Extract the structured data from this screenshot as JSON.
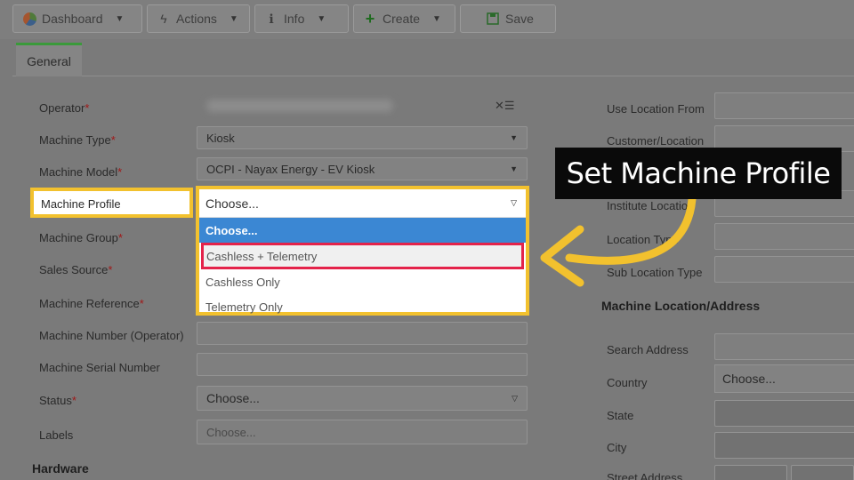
{
  "toolbar": {
    "dashboard": "Dashboard",
    "actions": "Actions",
    "info": "Info",
    "create": "Create",
    "save": "Save"
  },
  "tabs": {
    "general": "General"
  },
  "form": {
    "operator": "Operator",
    "machine_type": "Machine Type",
    "machine_type_value": "Kiosk",
    "machine_model": "Machine Model",
    "machine_model_value": "OCPI - Nayax Energy - EV Kiosk",
    "machine_profile": "Machine Profile",
    "machine_group": "Machine Group",
    "sales_source": "Sales Source",
    "machine_reference": "Machine Reference",
    "machine_number_operator": "Machine Number (Operator)",
    "machine_serial_number": "Machine Serial Number",
    "status": "Status",
    "status_value": "Choose...",
    "labels": "Labels",
    "labels_placeholder": "Choose...",
    "required_mark": "*"
  },
  "dropdown": {
    "current": "Choose...",
    "options": [
      "Choose...",
      "Cashless + Telemetry",
      "Cashless Only",
      "Telemetry Only"
    ]
  },
  "sections": {
    "hardware": "Hardware",
    "machine_location": "Machine Location/Address"
  },
  "right": {
    "use_location_from": "Use Location From",
    "customer_location": "Customer/Location",
    "institute_location": "Institute Location",
    "location_type": "Location Type",
    "sub_location_type": "Sub Location Type",
    "search_address": "Search Address",
    "country": "Country",
    "country_value": "Choose...",
    "state": "State",
    "city": "City",
    "street_address": "Street Address"
  },
  "callout": {
    "text": "Set Machine Profile"
  },
  "colors": {
    "highlight": "#f2c12e",
    "option_highlight": "#e4234a",
    "selected": "#3b87d3",
    "tab_accent": "#3a9a3a"
  }
}
